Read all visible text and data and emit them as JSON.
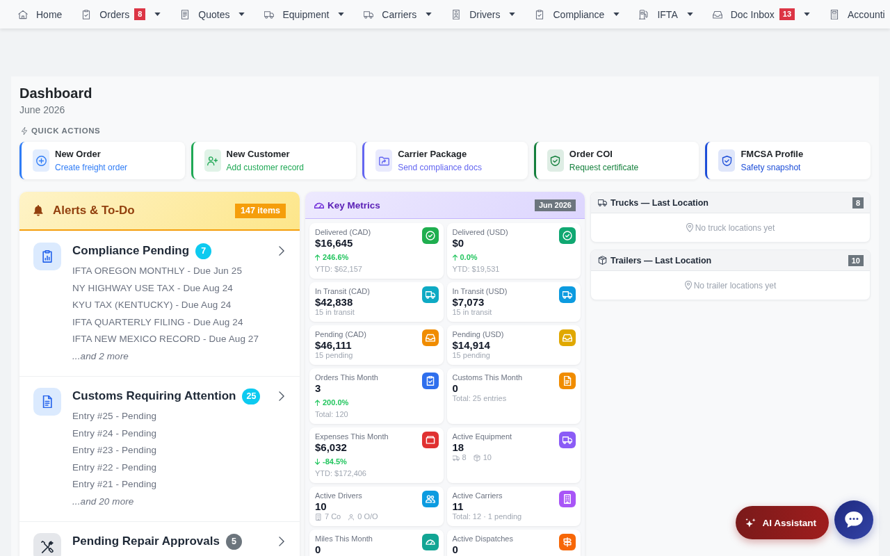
{
  "nav": [
    {
      "label": "Home",
      "dropdown": false
    },
    {
      "label": "Orders",
      "badge": "8",
      "dropdown": true
    },
    {
      "label": "Quotes",
      "dropdown": true
    },
    {
      "label": "Equipment",
      "dropdown": true
    },
    {
      "label": "Carriers",
      "dropdown": true
    },
    {
      "label": "Drivers",
      "dropdown": true
    },
    {
      "label": "Compliance",
      "dropdown": true
    },
    {
      "label": "IFTA",
      "dropdown": true
    },
    {
      "label": "Doc Inbox",
      "badge": "13",
      "dropdown": true
    },
    {
      "label": "Accounti",
      "dropdown": false
    }
  ],
  "page": {
    "title": "Dashboard",
    "subtitle": "June 2026",
    "quick_actions_label": "QUICK ACTIONS"
  },
  "quick_actions": [
    {
      "title": "New Order",
      "subtitle": "Create freight order",
      "color": "#2f7cf6"
    },
    {
      "title": "New Customer",
      "subtitle": "Add customer record",
      "color": "#1fa855"
    },
    {
      "title": "Carrier Package",
      "subtitle": "Send compliance docs",
      "color": "#6366f1"
    },
    {
      "title": "Order COI",
      "subtitle": "Request certificate",
      "color": "#15803d"
    },
    {
      "title": "FMCSA Profile",
      "subtitle": "Safety snapshot",
      "color": "#1d4ed8"
    }
  ],
  "alerts": {
    "title": "Alerts & To-Do",
    "count": "147 items",
    "sections": [
      {
        "kind": "compliance",
        "title": "Compliance Pending",
        "count": "7",
        "color": "#0dcaf0",
        "items": [
          "IFTA OREGON MONTHLY - Due Jun 25",
          "NY HIGHWAY USE TAX - Due Aug 24",
          "KYU TAX (KENTUCKY) - Due Aug 24",
          "IFTA QUARTERLY FILING - Due Aug 24",
          "IFTA NEW MEXICO RECORD - Due Aug 27"
        ],
        "more": "...and 2 more"
      },
      {
        "kind": "customs",
        "title": "Customs Requiring Attention",
        "count": "25",
        "color": "#0dcaf0",
        "items": [
          "Entry #25 - Pending",
          "Entry #24 - Pending",
          "Entry #23 - Pending",
          "Entry #22 - Pending",
          "Entry #21 - Pending"
        ],
        "more": "...and 20 more"
      },
      {
        "kind": "repair",
        "title": "Pending Repair Approvals",
        "count": "5",
        "color": "#6c757d"
      }
    ]
  },
  "metrics": {
    "title": "Key Metrics",
    "period": "Jun 2026",
    "cards": [
      {
        "kind": "trend",
        "label": "Delivered (CAD)",
        "value": "$16,645",
        "color": "#1fae4f",
        "change": {
          "up": true,
          "text": "246.6%"
        },
        "note": "YTD: $62,157"
      },
      {
        "kind": "trend",
        "label": "Delivered (USD)",
        "value": "$0",
        "color": "#10a872",
        "change": {
          "up": true,
          "text": "0.0%"
        },
        "note": "YTD: $19,531"
      },
      {
        "kind": "note",
        "label": "In Transit (CAD)",
        "value": "$42,838",
        "color": "#0eaac4",
        "note": "15 in transit"
      },
      {
        "kind": "note",
        "label": "In Transit (USD)",
        "value": "$7,073",
        "color": "#0c9be0",
        "note": "15 in transit"
      },
      {
        "kind": "note",
        "label": "Pending (CAD)",
        "value": "$46,111",
        "color": "#f08c00",
        "note": "15 pending"
      },
      {
        "kind": "note",
        "label": "Pending (USD)",
        "value": "$14,914",
        "color": "#e0a800",
        "note": "15 pending"
      },
      {
        "kind": "trend",
        "label": "Orders This Month",
        "value": "3",
        "color": "#2f6fed",
        "change": {
          "up": true,
          "text": "200.0%"
        },
        "note": "Total: 120"
      },
      {
        "kind": "note",
        "label": "Customs This Month",
        "value": "0",
        "color": "#f08c00",
        "note": "Total: 25 entries"
      },
      {
        "kind": "trend",
        "label": "Expenses This Month",
        "value": "$6,032",
        "color": "#e03131",
        "change": {
          "up": false,
          "text": "-84.5%"
        },
        "note": "YTD: $172,406"
      },
      {
        "kind": "counts",
        "label": "Active Equipment",
        "value": "18",
        "color": "#8b5cf6",
        "counts": [
          "8",
          "10"
        ]
      },
      {
        "kind": "counts",
        "label": "Active Drivers",
        "value": "10",
        "color": "#0c9be0",
        "counts": [
          "7 Co",
          "0 O/O"
        ]
      },
      {
        "kind": "note",
        "label": "Active Carriers",
        "value": "11",
        "color": "#a855f7",
        "note": "Total: 12 · 1 pending"
      },
      {
        "kind": "note",
        "label": "Miles This Month",
        "value": "0",
        "color": "#12a594"
      },
      {
        "kind": "note",
        "label": "Active Dispatches",
        "value": "0",
        "color": "#f76707"
      }
    ]
  },
  "locations": [
    {
      "kind": "truck",
      "title": "Trucks — Last Location",
      "count": "8",
      "empty": "No truck locations yet"
    },
    {
      "kind": "trailer",
      "title": "Trailers — Last Location",
      "count": "10",
      "empty": "No trailer locations yet"
    }
  ],
  "assistant": {
    "label": "AI Assistant"
  }
}
